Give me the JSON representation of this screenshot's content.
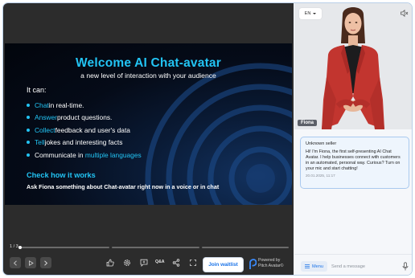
{
  "slide": {
    "title": "Welcome AI Chat-avatar",
    "subtitle": "a new level of interaction with your audience",
    "it_can": "It can:",
    "bullets": [
      {
        "highlight": "Chat",
        "rest": " in real-time."
      },
      {
        "highlight": "Answer",
        "rest": " product questions."
      },
      {
        "highlight": "Collect",
        "rest": " feedback and user's data"
      },
      {
        "highlight": "Tell",
        "rest": " jokes and interesting facts"
      },
      {
        "lead": "Communicate in ",
        "highlight": "multiple languages"
      }
    ],
    "check_title": "Check how it works",
    "check_text": "Ask Fiona something about Chat-avatar right now in a voice or in chat"
  },
  "player": {
    "slide_counter": "1 / 3",
    "progress": [
      0.0,
      0.0,
      0.0
    ],
    "qa_label": "Q&A",
    "waitlist_label": "Join waitlist",
    "powered_line1": "Powered by",
    "powered_line2": "Pitch Avatar©"
  },
  "avatar_panel": {
    "language": "EN",
    "name": "Fiona"
  },
  "chat": {
    "from": "Unknown seller",
    "message": "Hi! I'm Fiona, the first self-presenting AI Chat Avatar. I help businesses connect with customers in an automated, personal way. Curious? Turn on your mic and start chatting!",
    "timestamp": "20.01.2025, 11:17",
    "menu_label": "Menu",
    "input_placeholder": "Send a message"
  },
  "colors": {
    "accent": "#22c4f4",
    "link_blue": "#1a73e8",
    "jacket_red": "#c2352f"
  }
}
